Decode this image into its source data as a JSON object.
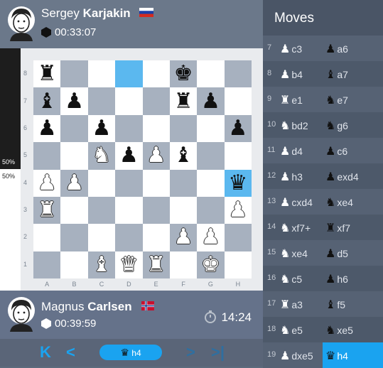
{
  "top_player": {
    "first": "Sergey",
    "last": "Karjakin",
    "flag": "russia-flag",
    "clock": "00:33:07"
  },
  "bottom_player": {
    "first": "Magnus",
    "last": "Carlsen",
    "flag": "norway-flag",
    "clock": "00:39:59"
  },
  "timer": "14:24",
  "eval": {
    "top": "50%",
    "bottom": "50%"
  },
  "board": {
    "files": [
      "A",
      "B",
      "C",
      "D",
      "E",
      "F",
      "G",
      "H"
    ],
    "ranks": [
      "8",
      "7",
      "6",
      "5",
      "4",
      "3",
      "2",
      "1"
    ],
    "highlight": [
      "d8",
      "h4"
    ],
    "pieces": {
      "a8": "bR",
      "f8": "bK",
      "a7": "bB",
      "b7": "bP",
      "f7": "bR",
      "g7": "bP",
      "a6": "bP",
      "c6": "bP",
      "h6": "bP",
      "c5": "wN",
      "d5": "bP",
      "e5": "wP",
      "f5": "bB",
      "a4": "wP",
      "b4": "wP",
      "h4": "bQ",
      "a3": "wR",
      "h3": "wP",
      "f2": "wP",
      "g2": "wP",
      "c1": "wB",
      "d1": "wQ",
      "e1": "wR",
      "g1": "wK"
    }
  },
  "nav": {
    "current_move": "h4",
    "current_piece": "bQ"
  },
  "moves_title": "Moves",
  "moves": [
    {
      "n": "7",
      "wp": "wP",
      "w": "c3",
      "bp": "bP",
      "b": "a6"
    },
    {
      "n": "8",
      "wp": "wP",
      "w": "b4",
      "bp": "bB",
      "b": "a7"
    },
    {
      "n": "9",
      "wp": "wR",
      "w": "e1",
      "bp": "bN",
      "b": "e7"
    },
    {
      "n": "10",
      "wp": "wN",
      "w": "bd2",
      "bp": "bN",
      "b": "g6"
    },
    {
      "n": "11",
      "wp": "wP",
      "w": "d4",
      "bp": "bP",
      "b": "c6"
    },
    {
      "n": "12",
      "wp": "wP",
      "w": "h3",
      "bp": "bP",
      "b": "exd4"
    },
    {
      "n": "13",
      "wp": "wP",
      "w": "cxd4",
      "bp": "bN",
      "b": "xe4"
    },
    {
      "n": "14",
      "wp": "wN",
      "w": "xf7+",
      "bp": "bR",
      "b": "xf7"
    },
    {
      "n": "15",
      "wp": "wN",
      "w": "xe4",
      "bp": "bP",
      "b": "d5"
    },
    {
      "n": "16",
      "wp": "wN",
      "w": "c5",
      "bp": "bP",
      "b": "h6"
    },
    {
      "n": "17",
      "wp": "wR",
      "w": "a3",
      "bp": "bB",
      "b": "f5"
    },
    {
      "n": "18",
      "wp": "wN",
      "w": "e5",
      "bp": "bN",
      "b": "xe5"
    },
    {
      "n": "19",
      "wp": "wP",
      "w": "dxe5",
      "bp": "bQ",
      "b": "h4"
    }
  ]
}
